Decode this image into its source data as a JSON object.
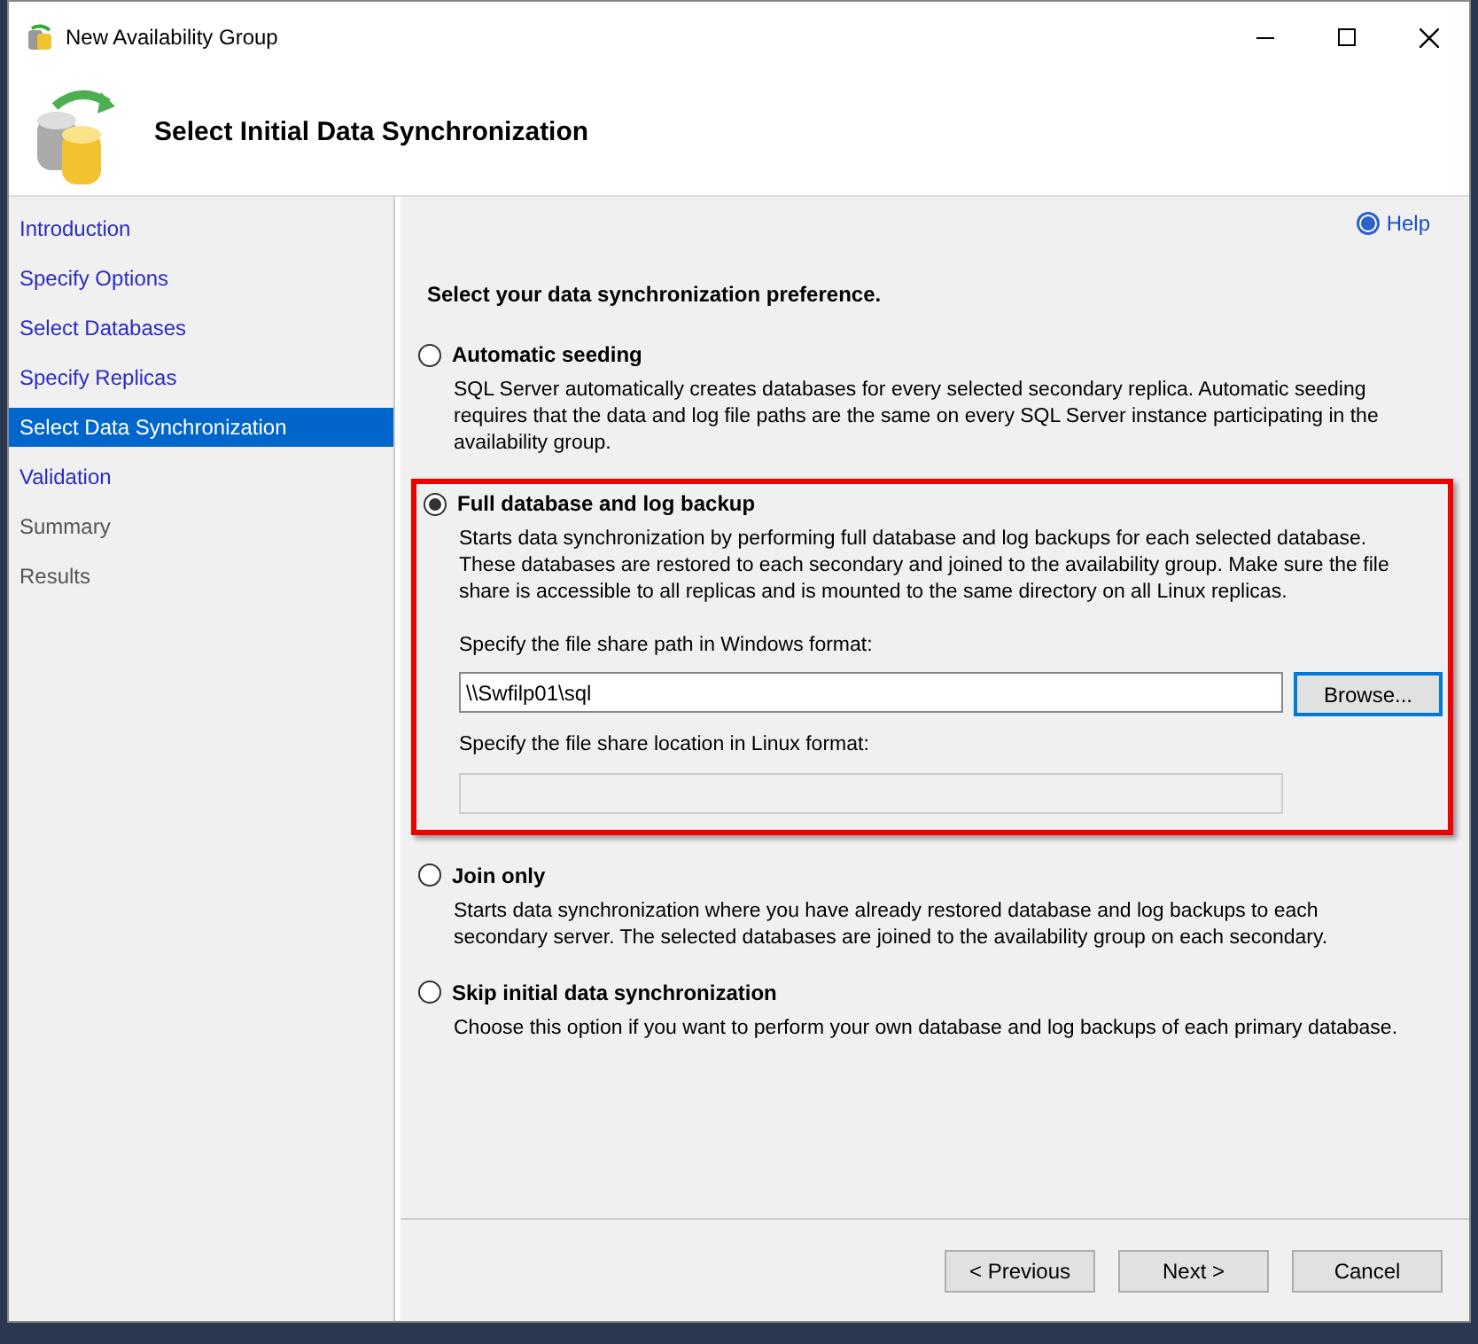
{
  "window": {
    "title": "New Availability Group"
  },
  "header": {
    "title": "Select Initial Data Synchronization"
  },
  "sidebar": {
    "items": [
      {
        "label": "Introduction",
        "selected": false,
        "disabled": false
      },
      {
        "label": "Specify Options",
        "selected": false,
        "disabled": false
      },
      {
        "label": "Select Databases",
        "selected": false,
        "disabled": false
      },
      {
        "label": "Specify Replicas",
        "selected": false,
        "disabled": false
      },
      {
        "label": "Select Data Synchronization",
        "selected": true,
        "disabled": false
      },
      {
        "label": "Validation",
        "selected": false,
        "disabled": false
      },
      {
        "label": "Summary",
        "selected": false,
        "disabled": true
      },
      {
        "label": "Results",
        "selected": false,
        "disabled": true
      }
    ]
  },
  "help": "Help",
  "prompt": "Select your data synchronization preference.",
  "options": [
    {
      "label": "Automatic seeding",
      "selected": false,
      "highlighted": false,
      "description": "SQL Server automatically creates databases for every selected secondary replica. Automatic seeding requires that the data and log file paths are the same on every SQL Server instance participating in the availability group."
    },
    {
      "label": "Full database and log backup",
      "selected": true,
      "highlighted": true,
      "description": "Starts data synchronization by performing full database and log backups for each selected database. These databases are restored to each secondary and joined to the availability group. Make sure the file share is accessible to all replicas and is mounted to the same directory on all Linux replicas.",
      "windows_path": {
        "label": "Specify the file share path in Windows format:",
        "value": "\\\\Swfilp01\\sql",
        "button": "Browse..."
      },
      "linux_path": {
        "label": "Specify the file share location in Linux format:",
        "disabled": true
      }
    },
    {
      "label": "Join only",
      "selected": false,
      "highlighted": false,
      "description": "Starts data synchronization where you have already restored database and log backups to each secondary server. The selected databases are joined to the availability group on each secondary."
    },
    {
      "label": "Skip initial data synchronization",
      "selected": false,
      "highlighted": false,
      "description": "Choose this option if you want to perform your own database and log backups of each primary database."
    }
  ],
  "buttons": [
    "< Previous",
    "Next >",
    "Cancel"
  ]
}
